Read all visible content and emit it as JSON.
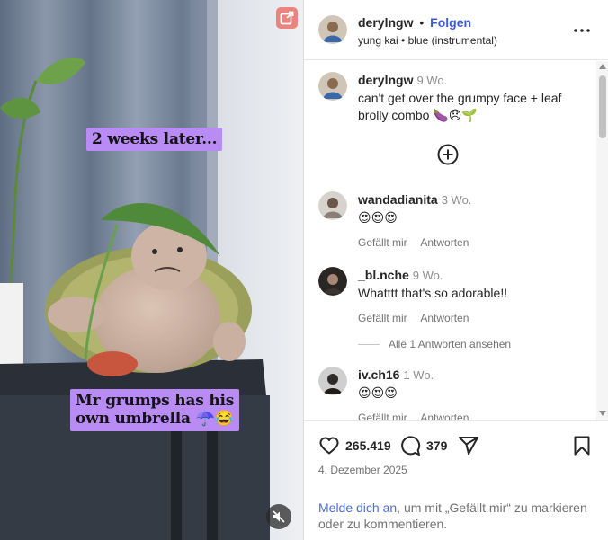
{
  "media": {
    "caption_top": "2 weeks later...",
    "caption_bottom_line1": "Mr grumps has his",
    "caption_bottom_line2": "own umbrella ☂️😂"
  },
  "header": {
    "username": "derylngw",
    "separator": "•",
    "follow_label": "Folgen",
    "audio": "yung kai • blue (instrumental)"
  },
  "caption_comment": {
    "username": "derylngw",
    "time": "9 Wo.",
    "text": "can't get over the grumpy face + leaf brolly combo",
    "emojis": "🍆😞🌱"
  },
  "comments": [
    {
      "username": "wandadianita",
      "time": "3 Wo.",
      "text": "😍😍😍",
      "like_label": "Gefällt mir",
      "reply_label": "Antworten"
    },
    {
      "username": "_bl.nche",
      "time": "9 Wo.",
      "text": "Whatttt that's so adorable!!",
      "like_label": "Gefällt mir",
      "reply_label": "Antworten"
    },
    {
      "username": "iv.ch16",
      "time": "1 Wo.",
      "text": "😍😍😍",
      "like_label": "Gefällt mir",
      "reply_label": "Antworten"
    }
  ],
  "view_replies": "Alle 1 Antworten ansehen",
  "actions": {
    "likes": "265.419",
    "comments": "379"
  },
  "date": "4. Dezember 2025",
  "login": {
    "link": "Melde dich an",
    "rest": ", um mit „Gefällt mir“ zu markieren oder zu kommentieren."
  },
  "icons": [
    "open-external-icon",
    "mute-icon",
    "more-icon",
    "add-circle-icon",
    "heart-icon",
    "comment-icon",
    "share-icon",
    "bookmark-icon"
  ],
  "colors": {
    "accent_link": "#3b5bdb",
    "caption_tag_bg": "#b98cf5",
    "open_button_bg": "#e9847e"
  }
}
